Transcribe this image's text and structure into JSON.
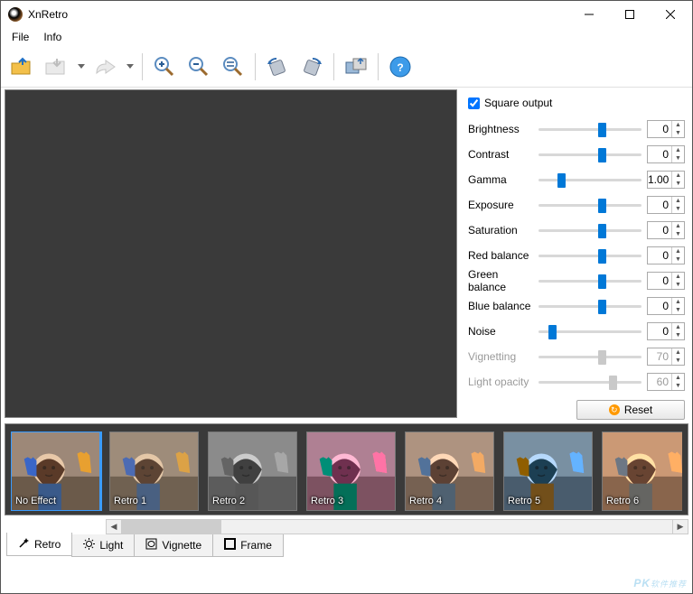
{
  "window": {
    "title": "XnRetro"
  },
  "menu": {
    "file": "File",
    "info": "Info"
  },
  "toolbar": {
    "open": "open",
    "save": "save",
    "share": "share",
    "zoom_in": "zoom-in",
    "zoom_out": "zoom-out",
    "zoom_fit": "zoom-fit",
    "rotate_left": "rotate-left",
    "rotate_right": "rotate-right",
    "compare": "compare",
    "help": "help"
  },
  "panel": {
    "square_output": {
      "label": "Square output",
      "checked": true
    },
    "sliders": [
      {
        "label": "Brightness",
        "value": "0",
        "pos": 58,
        "enabled": true
      },
      {
        "label": "Contrast",
        "value": "0",
        "pos": 58,
        "enabled": true
      },
      {
        "label": "Gamma",
        "value": "1.00",
        "pos": 18,
        "enabled": true
      },
      {
        "label": "Exposure",
        "value": "0",
        "pos": 58,
        "enabled": true
      },
      {
        "label": "Saturation",
        "value": "0",
        "pos": 58,
        "enabled": true
      },
      {
        "label": "Red balance",
        "value": "0",
        "pos": 58,
        "enabled": true
      },
      {
        "label": "Green balance",
        "value": "0",
        "pos": 58,
        "enabled": true
      },
      {
        "label": "Blue balance",
        "value": "0",
        "pos": 58,
        "enabled": true
      },
      {
        "label": "Noise",
        "value": "0",
        "pos": 10,
        "enabled": true
      },
      {
        "label": "Vignetting",
        "value": "70",
        "pos": 58,
        "enabled": false
      },
      {
        "label": "Light opacity",
        "value": "60",
        "pos": 68,
        "enabled": false
      }
    ],
    "reset": "Reset"
  },
  "filmstrip": {
    "items": [
      {
        "label": "No Effect",
        "selected": true,
        "style": "normal"
      },
      {
        "label": "Retro 1",
        "selected": false,
        "style": "retro1"
      },
      {
        "label": "Retro 2",
        "selected": false,
        "style": "retro2"
      },
      {
        "label": "Retro 3",
        "selected": false,
        "style": "retro3"
      },
      {
        "label": "Retro 4",
        "selected": false,
        "style": "retro4"
      },
      {
        "label": "Retro 5",
        "selected": false,
        "style": "retro5"
      },
      {
        "label": "Retro 6",
        "selected": false,
        "style": "retro6"
      }
    ]
  },
  "tabs": [
    {
      "label": "Retro",
      "icon": "wand",
      "active": true
    },
    {
      "label": "Light",
      "icon": "sun",
      "active": false
    },
    {
      "label": "Vignette",
      "icon": "vignette",
      "active": false
    },
    {
      "label": "Frame",
      "icon": "frame",
      "active": false
    }
  ],
  "watermark": {
    "big": "PK",
    "small": "软件推荐"
  }
}
